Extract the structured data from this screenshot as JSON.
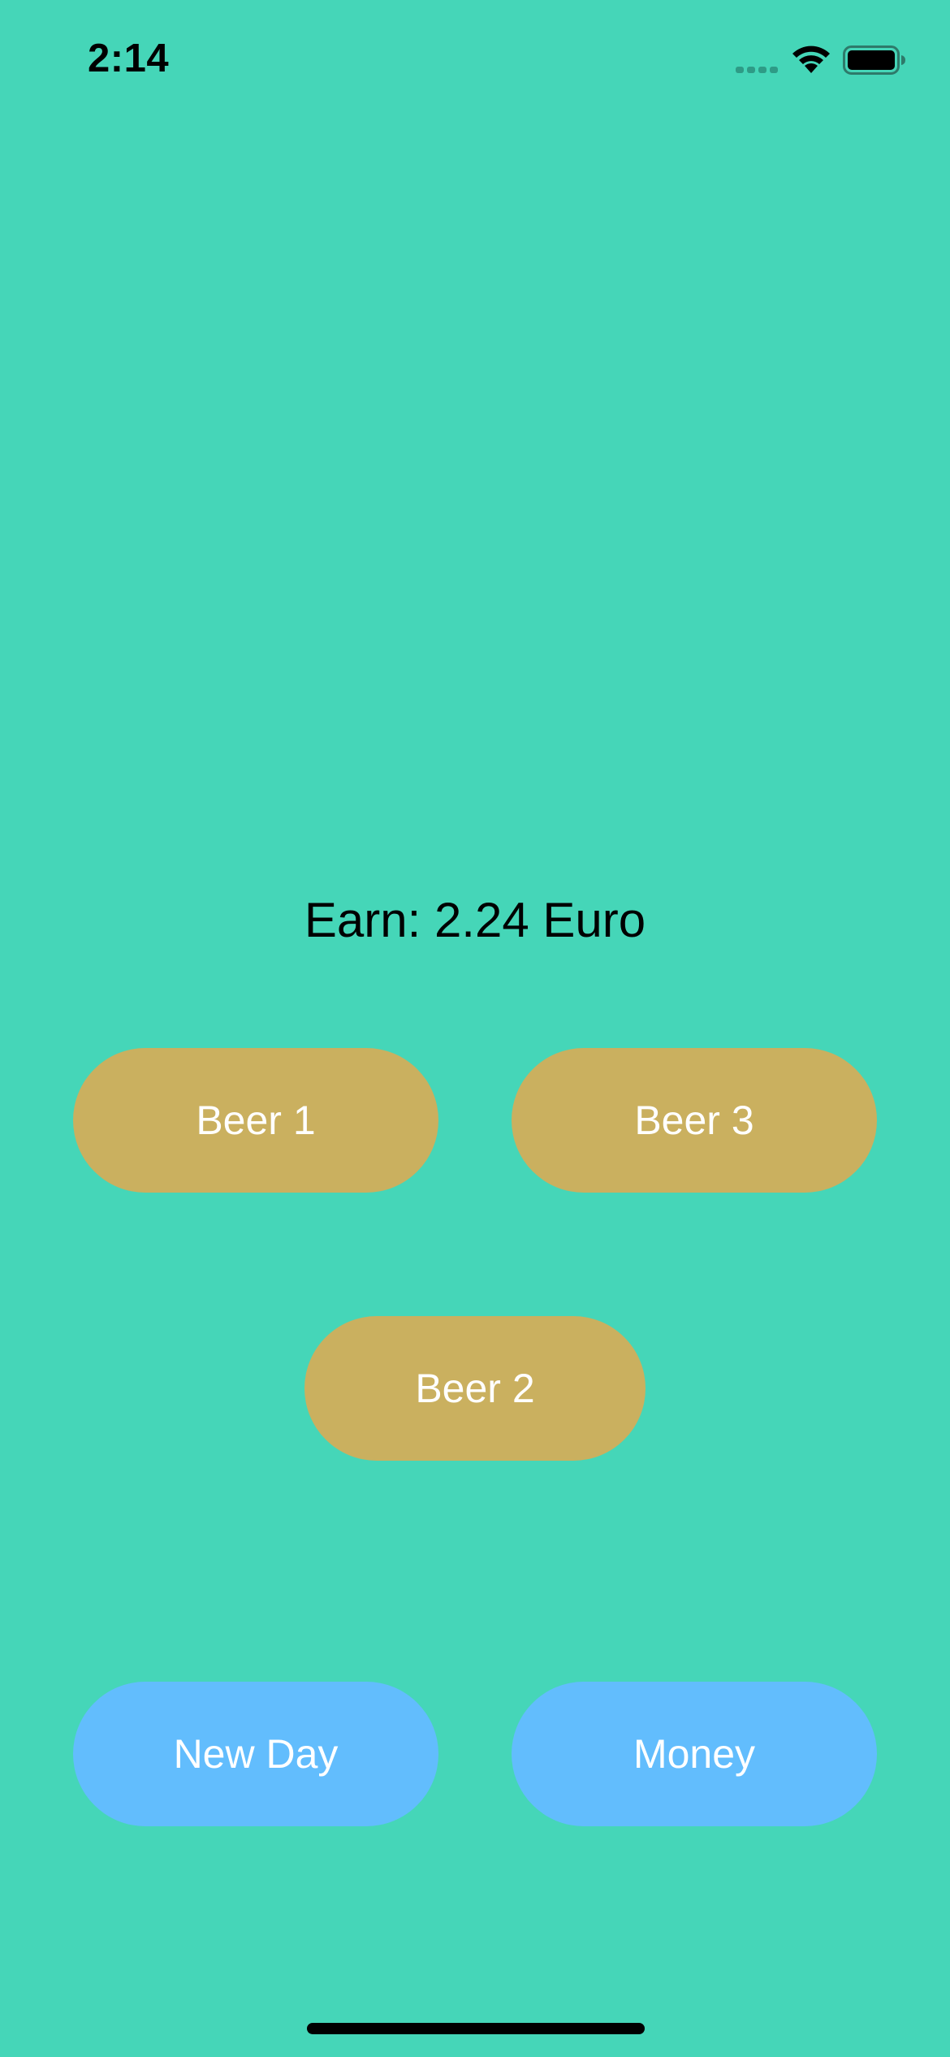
{
  "status_bar": {
    "time": "2:14",
    "icons": [
      "cellular-signal-icon",
      "wifi-icon",
      "battery-icon"
    ]
  },
  "earnings": {
    "text": "Earn: 2.24 Euro"
  },
  "buttons": {
    "beer1": "Beer 1",
    "beer3": "Beer 3",
    "beer2": "Beer 2",
    "new_day": "New Day",
    "money": "Money"
  },
  "colors": {
    "background": "#45d6b8",
    "beer_button": "#cab05f",
    "action_button": "#62bdfd",
    "button_text": "#ffffff"
  }
}
